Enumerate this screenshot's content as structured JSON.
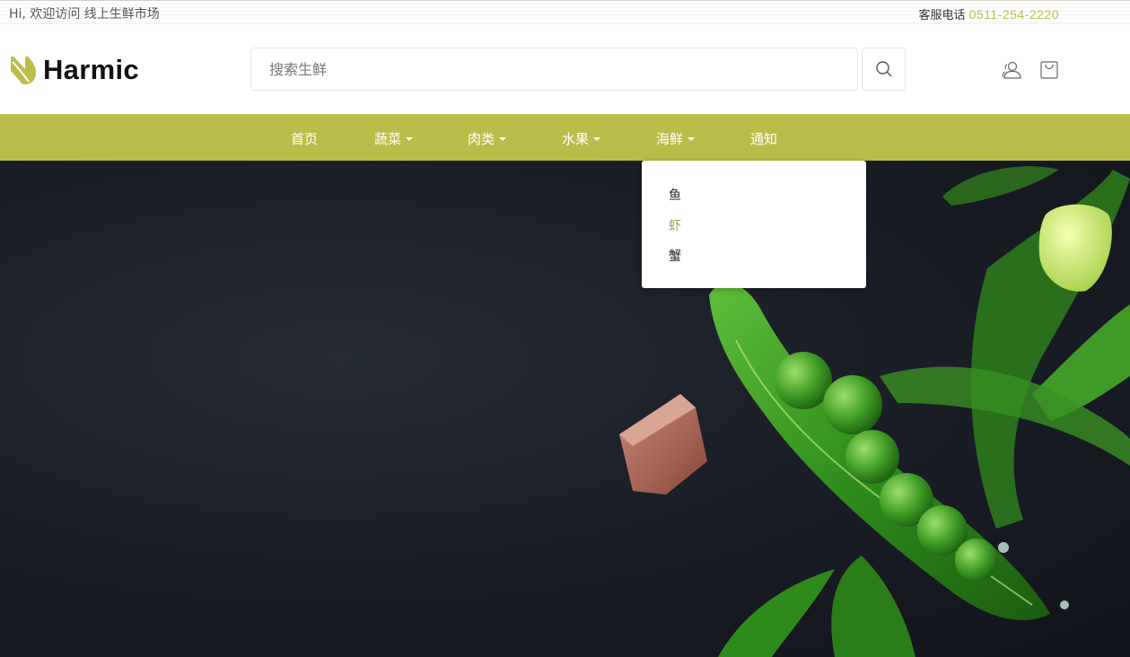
{
  "topbar": {
    "welcome": "Hi, 欢迎访问 线上生鲜市场",
    "hotline_label": "客服电话",
    "hotline_number": "0511-254-2220"
  },
  "header": {
    "logo_text": "Harmic",
    "search_placeholder": "搜索生鲜",
    "search_value": ""
  },
  "nav": {
    "items": [
      {
        "label": "首页",
        "has_dropdown": false
      },
      {
        "label": "蔬菜",
        "has_dropdown": true
      },
      {
        "label": "肉类",
        "has_dropdown": true
      },
      {
        "label": "水果",
        "has_dropdown": true
      },
      {
        "label": "海鲜",
        "has_dropdown": true
      },
      {
        "label": "通知",
        "has_dropdown": false
      }
    ]
  },
  "dropdown": {
    "parent": "海鲜",
    "items": [
      {
        "label": "鱼",
        "active": false
      },
      {
        "label": "虾",
        "active": true
      },
      {
        "label": "蟹",
        "active": false
      }
    ]
  },
  "icons": {
    "search": "search-icon",
    "account": "user-icon",
    "cart": "shopping-bag-icon",
    "logo": "leaf-logo-icon"
  },
  "colors": {
    "brand": "#bbbd49",
    "hotline": "#bcc04c",
    "hero_background": "#1b1f27",
    "pea_green": "#3e9a24"
  }
}
